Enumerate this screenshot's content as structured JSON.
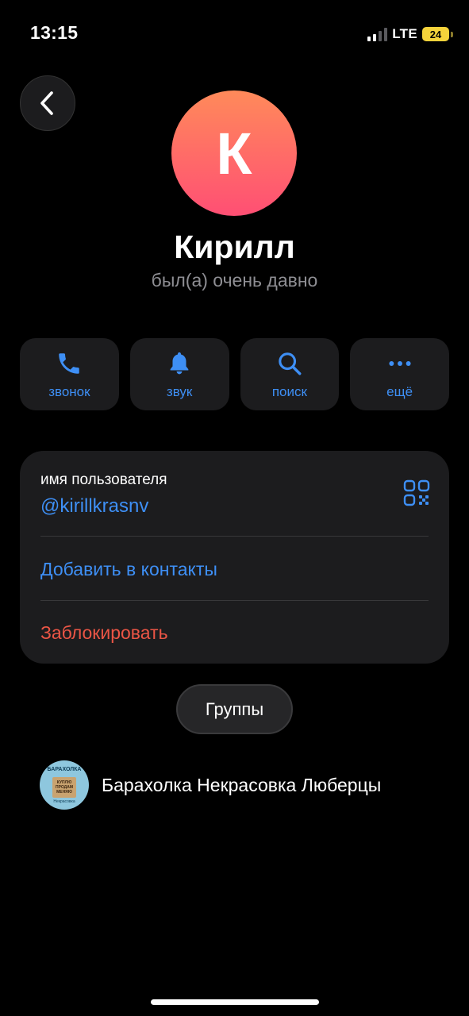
{
  "status_bar": {
    "time": "13:15",
    "network": "LTE",
    "battery_level": "24"
  },
  "profile": {
    "avatar_letter": "К",
    "avatar_gradient": [
      "#ff8a5a",
      "#ff4f74"
    ],
    "name": "Кирилл",
    "status": "был(а) очень давно"
  },
  "actions": [
    {
      "label": "звонок",
      "icon": "phone-icon"
    },
    {
      "label": "звук",
      "icon": "bell-icon"
    },
    {
      "label": "поиск",
      "icon": "search-icon"
    },
    {
      "label": "ещё",
      "icon": "more-icon"
    }
  ],
  "info": {
    "username_caption": "имя пользователя",
    "username": "@kirillkrasnv",
    "add_contact": "Добавить в контакты",
    "block": "Заблокировать"
  },
  "groups_tab_label": "Группы",
  "groups": [
    {
      "name": "Барахолка Некрасовка Люберцы",
      "avatar_text_top": "БАРАХОЛКА",
      "avatar_text_box": "КУПЛЮ ПРОДАМ МЕНЯЮ",
      "avatar_text_bottom": "Некрасовка"
    }
  ],
  "colors": {
    "accent": "#3e8ff5",
    "danger": "#eb5545",
    "card": "#1c1c1e",
    "background": "#000000"
  }
}
